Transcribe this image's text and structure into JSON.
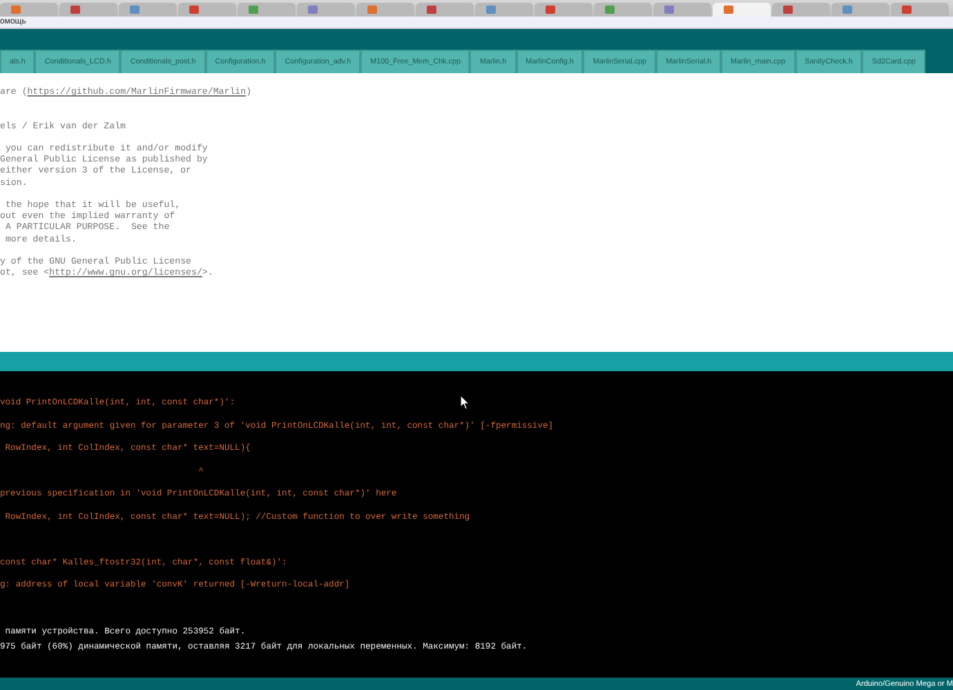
{
  "browser_tabs": [
    {
      "selected": false
    },
    {
      "selected": false
    },
    {
      "selected": false
    },
    {
      "selected": false
    },
    {
      "selected": false
    },
    {
      "selected": false
    },
    {
      "selected": false
    },
    {
      "selected": false
    },
    {
      "selected": false
    },
    {
      "selected": false
    },
    {
      "selected": false
    },
    {
      "selected": false
    },
    {
      "selected": true
    },
    {
      "selected": false
    },
    {
      "selected": false
    },
    {
      "selected": false
    }
  ],
  "menu_bar": {
    "items": [
      "омощь"
    ]
  },
  "file_tabs": [
    {
      "label": "als.h",
      "selected": false
    },
    {
      "label": "Conditionals_LCD.h",
      "selected": false
    },
    {
      "label": "Conditionals_post.h",
      "selected": false
    },
    {
      "label": "Configuration.h",
      "selected": false
    },
    {
      "label": "Configuration_adv.h",
      "selected": false
    },
    {
      "label": "M100_Free_Mem_Chk.cpp",
      "selected": false
    },
    {
      "label": "Marlin.h",
      "selected": false
    },
    {
      "label": "MarlinConfig.h",
      "selected": false
    },
    {
      "label": "MarlinSerial.cpp",
      "selected": false
    },
    {
      "label": "MarlinSerial.h",
      "selected": false
    },
    {
      "label": "Marlin_main.cpp",
      "selected": false
    },
    {
      "label": "SanityCheck.h",
      "selected": false
    },
    {
      "label": "Sd2Card.cpp",
      "selected": false
    }
  ],
  "editor": {
    "paragraphs": [
      [
        [
          {
            "kind": "plain",
            "text": "are ("
          },
          {
            "kind": "link",
            "text": "https://github.com/MarlinFirmware/Marlin"
          },
          {
            "kind": "plain",
            "text": ")"
          }
        ]
      ],
      [
        [
          {
            "kind": "plain",
            "text": "els / Erik van der Zalm"
          }
        ]
      ],
      [
        [
          {
            "kind": "plain",
            "text": " you can redistribute it and/or modify"
          }
        ],
        [
          {
            "kind": "plain",
            "text": "General Public License as published by"
          }
        ],
        [
          {
            "kind": "plain",
            "text": "either version 3 of the License, or"
          }
        ],
        [
          {
            "kind": "plain",
            "text": "sion."
          }
        ]
      ],
      [
        [
          {
            "kind": "plain",
            "text": " the hope that it will be useful,"
          }
        ],
        [
          {
            "kind": "plain",
            "text": "out even the implied warranty of"
          }
        ],
        [
          {
            "kind": "plain",
            "text": " A PARTICULAR PURPOSE.  See the"
          }
        ],
        [
          {
            "kind": "plain",
            "text": " more details."
          }
        ]
      ],
      [
        [
          {
            "kind": "plain",
            "text": "y of the GNU General Public License"
          }
        ],
        [
          {
            "kind": "plain",
            "text": "ot, see <"
          },
          {
            "kind": "link",
            "text": "http://www.gnu.org/licenses/"
          },
          {
            "kind": "plain",
            "text": ">."
          }
        ]
      ]
    ]
  },
  "console": {
    "blocks": [
      {
        "kind": "error",
        "lines": [
          "void PrintOnLCDKalle(int, int, const char*)':",
          "ng: default argument given for parameter 3 of 'void PrintOnLCDKalle(int, int, const char*)' [-fpermissive]",
          " RowIndex, int ColIndex, const char* text=NULL){",
          "                                      ^",
          "previous specification in 'void PrintOnLCDKalle(int, int, const char*)' here",
          " RowIndex, int ColIndex, const char* text=NULL); //Custom function to over write something"
        ]
      },
      {
        "kind": "error",
        "lines": [
          "const char* Kalles_ftostr32(int, char*, const float&)':",
          "g: address of local variable 'convK' returned [-Wreturn-local-addr]"
        ]
      },
      {
        "kind": "info",
        "lines": [
          " памяти устройства. Всего доступно 253952 байт.",
          "975 байт (60%) динамической памяти, оставляя 3217 байт для локальных переменных. Максимум: 8192 байт."
        ]
      }
    ]
  },
  "status_bar": {
    "board": "Arduino/Genuino Mega or M"
  }
}
